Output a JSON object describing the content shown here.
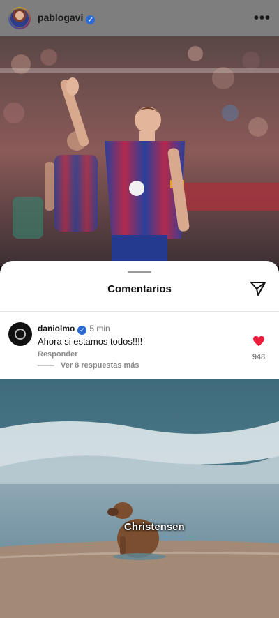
{
  "post": {
    "username": "pablogavi",
    "verified_mark": "✓",
    "more_label": "•••",
    "avatar_icon": "profile-avatar"
  },
  "sheet": {
    "title": "Comentarios",
    "share_icon": "send-icon"
  },
  "comment": {
    "username": "daniolmo",
    "verified_mark": "✓",
    "time": "5 min",
    "text": "Ahora si estamos todos!!!!",
    "reply_label": "Responder",
    "view_replies_label": "Ver 8 respuestas más",
    "likes": "948",
    "like_color": "#ed1c3c"
  },
  "meme": {
    "caption": "Christensen"
  },
  "colors": {
    "header_bg": "#7e7e7e",
    "verified_blue": "#2c6bd6"
  }
}
